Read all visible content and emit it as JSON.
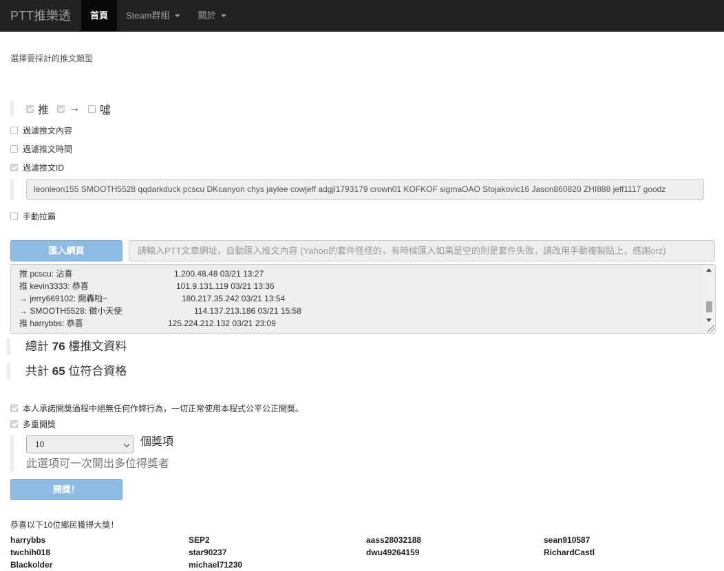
{
  "navbar": {
    "brand": "PTT推樂透",
    "items": [
      {
        "label": "首頁",
        "active": true
      },
      {
        "label": "Steam群組",
        "dropdown": true
      },
      {
        "label": "關於",
        "dropdown": true
      }
    ]
  },
  "filter": {
    "section_label": "選擇要採計的推文類型",
    "types": [
      {
        "label": "推",
        "checked": true
      },
      {
        "label": "→",
        "checked": true
      },
      {
        "label": "噓",
        "checked": false
      }
    ],
    "filter_content": {
      "label": "過濾推文內容",
      "checked": false
    },
    "filter_time": {
      "label": "過濾推文時間",
      "checked": false
    },
    "filter_id": {
      "label": "過濾推文ID",
      "checked": true
    },
    "id_list": "leonleon155 SMOOTH5528 qqdarkduck pcscu DKcanyon chys jaylee cowjeff adgjl1793179 crown01 KOFKOF sigmaOAO Stojakovic16 Jason860820 ZHI888 jeff1117 goodz",
    "manual_blacklist": {
      "label": "手動拉霸",
      "checked": false
    }
  },
  "import": {
    "button_label": "匯入網頁",
    "url_placeholder": "請輸入PTT文章網址，自動匯入推文內容 (Yahoo的套件怪怪的，有時候匯入如果是空的則是套件失敗，請改用手動複製貼上，感謝orz)"
  },
  "comments": [
    {
      "type": "推",
      "user": "pcscu",
      "text": "沾喜",
      "ip": "1.200.48.48",
      "date": "03/21",
      "time": "13:27"
    },
    {
      "type": "推",
      "user": "kevin3333",
      "text": "恭喜",
      "ip": "101.9.131.119",
      "date": "03/21",
      "time": "13:36"
    },
    {
      "type": "→",
      "user": "jerry669102",
      "text": "開轟啦~",
      "ip": "180.217.35.242",
      "date": "03/21",
      "time": "13:54"
    },
    {
      "type": "→",
      "user": "SMOOTH5528",
      "text": "徵小天使",
      "ip": "114.137.213.186",
      "date": "03/21",
      "time": "15:58"
    },
    {
      "type": "推",
      "user": "harrybbs",
      "text": "恭喜",
      "ip": "125.224.212.132",
      "date": "03/21",
      "time": "23:09"
    }
  ],
  "stats": {
    "total_prefix": "總計",
    "total_count": "76",
    "total_suffix": "樓推文資料",
    "qualified_prefix": "共計",
    "qualified_count": "65",
    "qualified_suffix": "位符合資格"
  },
  "draw": {
    "pledge": {
      "label": "本人承諾開獎過程中絕無任何作弊行為，一切正常使用本程式公平公正開獎。",
      "checked": true
    },
    "multi": {
      "label": "多重開獎",
      "checked": true
    },
    "award_count": "10",
    "award_unit": "個獎項",
    "hint": "此選項可一次開出多位得獎者",
    "button_label": "開獎！"
  },
  "winners": {
    "title": "恭喜以下10位鄉民獲得大獎！",
    "names": [
      "harrybbs",
      "SEP2",
      "aass28032188",
      "sean910587",
      "twchih018",
      "star90237",
      "dwu49264159",
      "RichardCastl",
      "Blackolder",
      "michael71230"
    ]
  },
  "colors": {
    "navbar_bg": "#222222",
    "button_primary": "#8ebbe3"
  }
}
